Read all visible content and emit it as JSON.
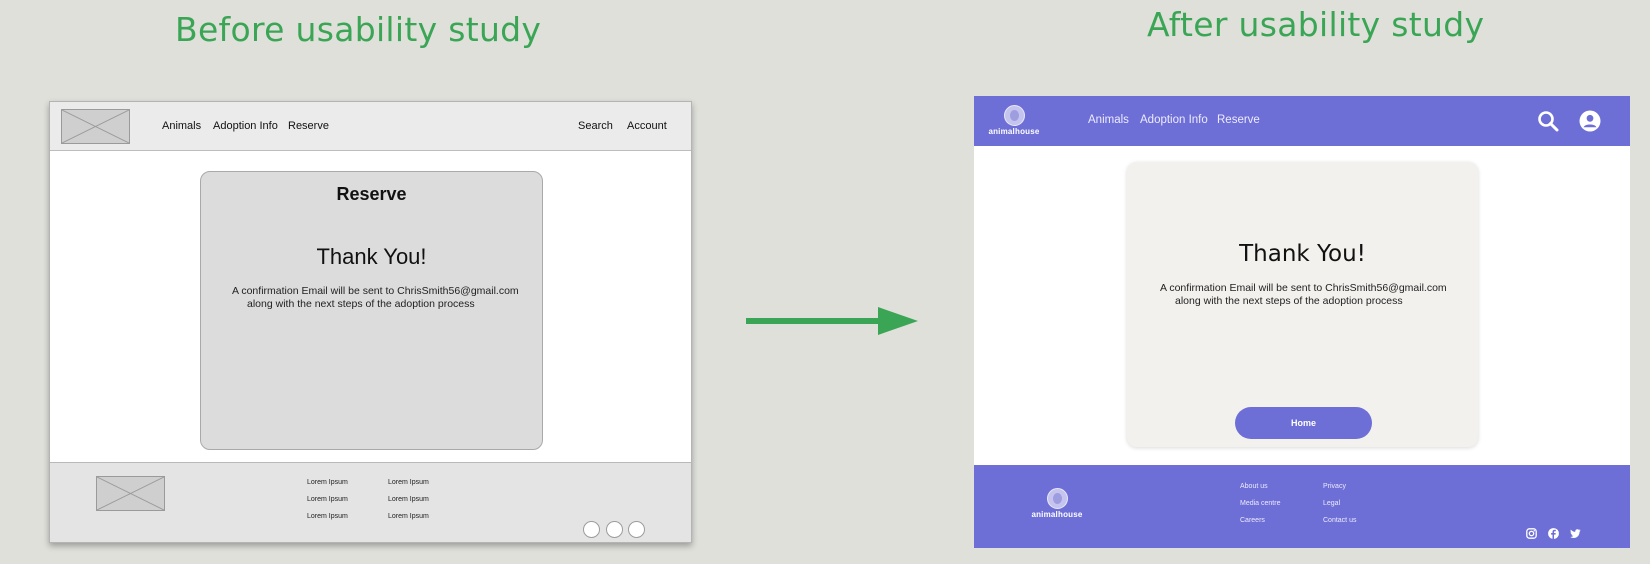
{
  "headings": {
    "before": "Before usability study",
    "after": "After usability study"
  },
  "colors": {
    "heading": "#3aa655",
    "brand_purple": "#6e6ed7",
    "arrow": "#3aa655"
  },
  "wireframe": {
    "nav": {
      "links": [
        "Animals",
        "Adoption Info",
        "Reserve"
      ],
      "search": "Search",
      "account": "Account"
    },
    "card": {
      "title": "Reserve",
      "heading": "Thank You!",
      "line1": "A confirmation Email will be sent to ChrisSmith56@gmail.com",
      "line2": "along with the next steps of the adoption process"
    },
    "footer": {
      "col1": [
        "Lorem Ipsum",
        "Lorem Ipsum",
        "Lorem Ipsum"
      ],
      "col2": [
        "Lorem Ipsum",
        "Lorem Ipsum",
        "Lorem Ipsum"
      ]
    }
  },
  "hifi": {
    "brand": "animalhouse",
    "nav": {
      "links": [
        "Animals",
        "Adoption Info",
        "Reserve"
      ],
      "icons": [
        "search-icon",
        "account-icon"
      ]
    },
    "card": {
      "heading": "Thank You!",
      "line1": "A confirmation Email will be sent to ChrisSmith56@gmail.com",
      "line2": "along with the next steps of the adoption process",
      "button": "Home"
    },
    "footer": {
      "col1": [
        "About us",
        "Media centre",
        "Careers"
      ],
      "col2": [
        "Privacy",
        "Legal",
        "Contact us"
      ],
      "social": [
        "instagram-icon",
        "facebook-icon",
        "twitter-icon"
      ]
    }
  }
}
